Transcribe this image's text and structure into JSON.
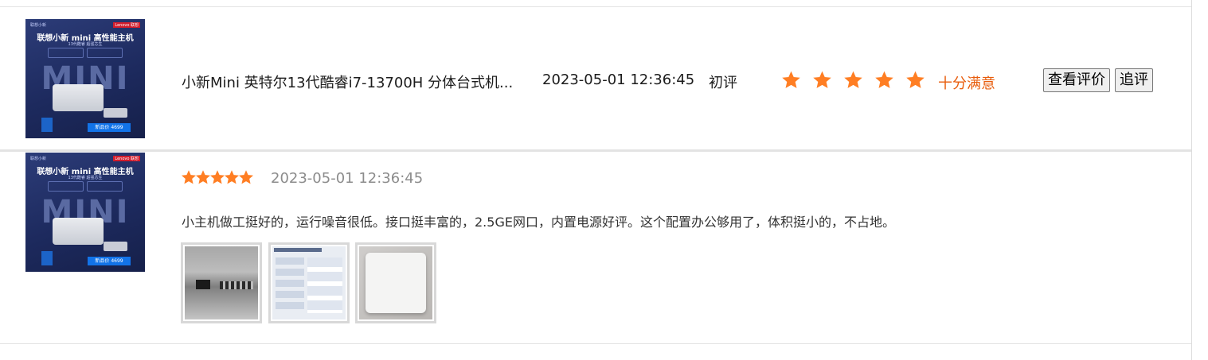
{
  "product": {
    "thumbnail": {
      "brand_left": "联想小新",
      "brand_right": "Lenovo 联想",
      "title": "联想小新 mini 高性能主机",
      "subtitle": "13代酷睿 超强芯生",
      "big_text": "MINI",
      "price_tag": "新品价 4699"
    },
    "name": "小新Mini 英特尔13代酷睿i7-13700H 分体台式机...",
    "date": "2023-05-01 12:36:45",
    "review_type": "初评",
    "rating": 5,
    "rating_text": "十分满意",
    "view_button": "查看评价",
    "followup_button": "追评"
  },
  "review": {
    "rating": 5,
    "date": "2023-05-01 12:36:45",
    "text": "小主机做工挺好的，运行噪音很低。接口挺丰富的，2.5GE网口，内置电源好评。这个配置办公够用了，体积挺小的，不占地。",
    "photos": [
      "rear-ports-photo",
      "system-info-screen-photo",
      "white-device-photo"
    ]
  },
  "colors": {
    "star_orange": "#ff7e23",
    "rating_text": "#e85d0d",
    "muted_date": "#8c8c8c"
  }
}
